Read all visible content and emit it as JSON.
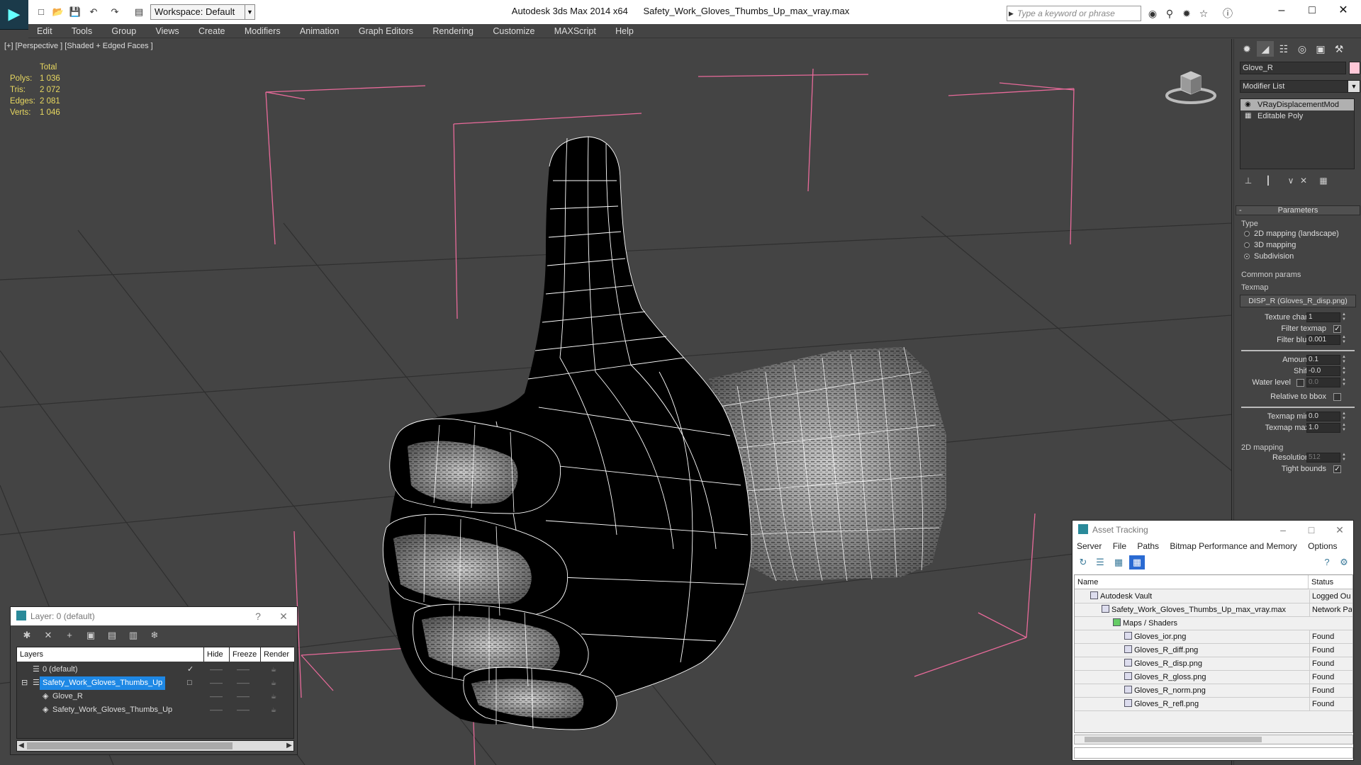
{
  "titlebar": {
    "app_title": "Autodesk 3ds Max  2014 x64",
    "file_title": "Safety_Work_Gloves_Thumbs_Up_max_vray.max",
    "workspace": "Workspace: Default",
    "search_placeholder": "Type a keyword or phrase"
  },
  "menu": [
    "Edit",
    "Tools",
    "Group",
    "Views",
    "Create",
    "Modifiers",
    "Animation",
    "Graph Editors",
    "Rendering",
    "Customize",
    "MAXScript",
    "Help"
  ],
  "viewport": {
    "label": "[+] [Perspective ] [Shaded + Edged Faces ]",
    "stats": {
      "header": "Total",
      "rows": [
        {
          "k": "Polys:",
          "v": "1 036"
        },
        {
          "k": "Tris:",
          "v": "2 072"
        },
        {
          "k": "Edges:",
          "v": "2 081"
        },
        {
          "k": "Verts:",
          "v": "1 046"
        }
      ]
    }
  },
  "command_panel": {
    "object_name": "Glove_R",
    "modifier_list": "Modifier List",
    "stack": [
      "VRayDisplacementMod",
      "Editable Poly"
    ],
    "rollout": "Parameters",
    "type_label": "Type",
    "type_options": [
      "2D mapping (landscape)",
      "3D mapping",
      "Subdivision"
    ],
    "common_label": "Common params",
    "texmap_label": "Texmap",
    "texmap_value": "DISP_R (Gloves_R_disp.png)",
    "texture_chan_label": "Texture chan",
    "texture_chan_value": "1",
    "filter_texmap_label": "Filter texmap",
    "filter_blur_label": "Filter blur",
    "filter_blur_value": "0.001",
    "amount_label": "Amount",
    "amount_value": "0.1",
    "shift_label": "Shift",
    "shift_value": "-0.0",
    "water_level_label": "Water level",
    "water_level_value": "0.0",
    "relative_bbox_label": "Relative to bbox",
    "texmap_min_label": "Texmap min",
    "texmap_min_value": "0.0",
    "texmap_max_label": "Texmap max",
    "texmap_max_value": "1.0",
    "mapping2d_label": "2D mapping",
    "resolution_label": "Resolution",
    "resolution_value": "512",
    "tight_bounds_label": "Tight bounds"
  },
  "layer_window": {
    "title": "Layer: 0 (default)",
    "help": "?",
    "columns": [
      "Layers",
      "Hide",
      "Freeze",
      "Render"
    ],
    "rows": [
      {
        "name": "0 (default)"
      },
      {
        "name": "Safety_Work_Gloves_Thumbs_Up"
      },
      {
        "name": "Glove_R"
      },
      {
        "name": "Safety_Work_Gloves_Thumbs_Up"
      }
    ]
  },
  "asset_window": {
    "title": "Asset Tracking",
    "menu": [
      "Server",
      "File",
      "Paths",
      "Bitmap Performance and Memory",
      "Options"
    ],
    "columns": [
      "Name",
      "Status"
    ],
    "rows": [
      {
        "name": "Autodesk Vault",
        "status": "Logged Ou"
      },
      {
        "name": "Safety_Work_Gloves_Thumbs_Up_max_vray.max",
        "status": "Network Pa"
      },
      {
        "name": "Maps / Shaders",
        "status": ""
      },
      {
        "name": "Gloves_ior.png",
        "status": "Found"
      },
      {
        "name": "Gloves_R_diff.png",
        "status": "Found"
      },
      {
        "name": "Gloves_R_disp.png",
        "status": "Found"
      },
      {
        "name": "Gloves_R_gloss.png",
        "status": "Found"
      },
      {
        "name": "Gloves_R_norm.png",
        "status": "Found"
      },
      {
        "name": "Gloves_R_refl.png",
        "status": "Found"
      }
    ]
  }
}
